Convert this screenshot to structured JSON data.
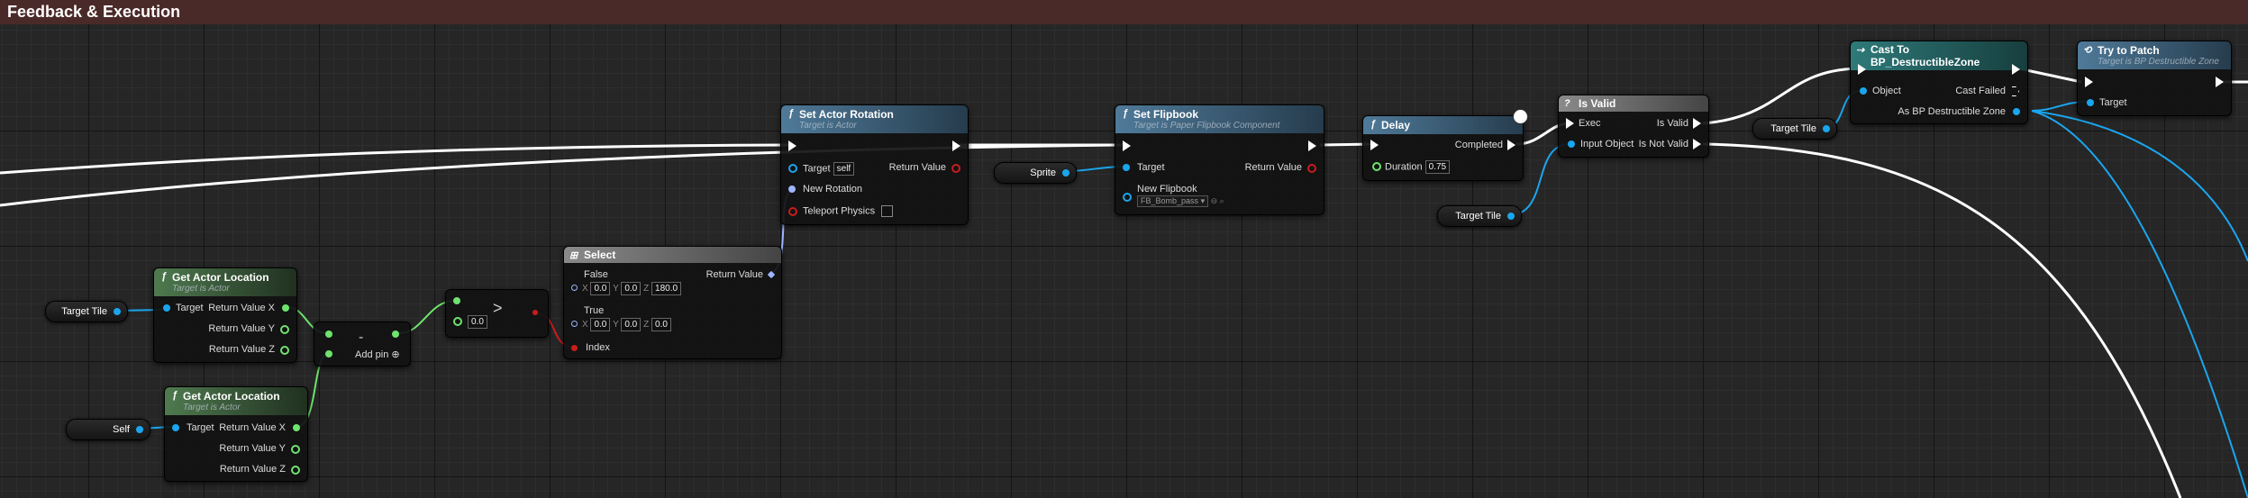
{
  "comment_title": "Feedback & Execution",
  "nodes": {
    "get_actor_location_1": {
      "title": "Get Actor Location",
      "subtitle": "Target is Actor",
      "target": "Target",
      "rx": "Return Value X",
      "ry": "Return Value Y",
      "rz": "Return Value Z"
    },
    "get_actor_location_2": {
      "title": "Get Actor Location",
      "subtitle": "Target is Actor",
      "target": "Target",
      "rx": "Return Value X",
      "ry": "Return Value Y",
      "rz": "Return Value Z"
    },
    "subtract": {
      "op": "-",
      "add_pin": "Add pin"
    },
    "greater": {
      "op": ">",
      "b_value": "0.0"
    },
    "select": {
      "title": "Select",
      "false_label": "False",
      "true_label": "True",
      "return_value": "Return Value",
      "index": "Index",
      "false_x": "0.0",
      "false_y": "0.0",
      "false_z": "180.0",
      "true_x": "0.0",
      "true_y": "0.0",
      "true_z": "0.0",
      "lx": "X",
      "ly": "Y",
      "lz": "Z"
    },
    "set_actor_rotation": {
      "title": "Set Actor Rotation",
      "subtitle": "Target is Actor",
      "target": "Target",
      "target_value": "self",
      "new_rotation": "New Rotation",
      "teleport": "Teleport Physics",
      "return_value": "Return Value"
    },
    "set_flipbook": {
      "title": "Set Flipbook",
      "subtitle": "Target is Paper Flipbook Component",
      "target": "Target",
      "new_flipbook": "New Flipbook",
      "flipbook_value": "FB_Bomb_pass",
      "return_value": "Return Value"
    },
    "delay": {
      "title": "Delay",
      "completed": "Completed",
      "duration": "Duration",
      "duration_value": "0.75"
    },
    "is_valid": {
      "title": "Is Valid",
      "exec": "Exec",
      "input_object": "Input Object",
      "is_valid": "Is Valid",
      "is_not_valid": "Is Not Valid"
    },
    "cast": {
      "title": "Cast To BP_DestructibleZone",
      "object": "Object",
      "cast_failed": "Cast Failed",
      "as_bp": "As BP Destructible Zone"
    },
    "try_to_patch": {
      "title": "Try to Patch",
      "subtitle": "Target is BP Destructible Zone",
      "target": "Target"
    }
  },
  "variables": {
    "target_tile_1": "Target Tile",
    "self": "Self",
    "sprite": "Sprite",
    "target_tile_2": "Target Tile",
    "target_tile_3": "Target Tile"
  },
  "colors": {
    "comment_bar": "#4a2a28",
    "object_pin": "#1aa6ee",
    "float_pin": "#6ee36e",
    "exec_wire": "#ffffff"
  }
}
